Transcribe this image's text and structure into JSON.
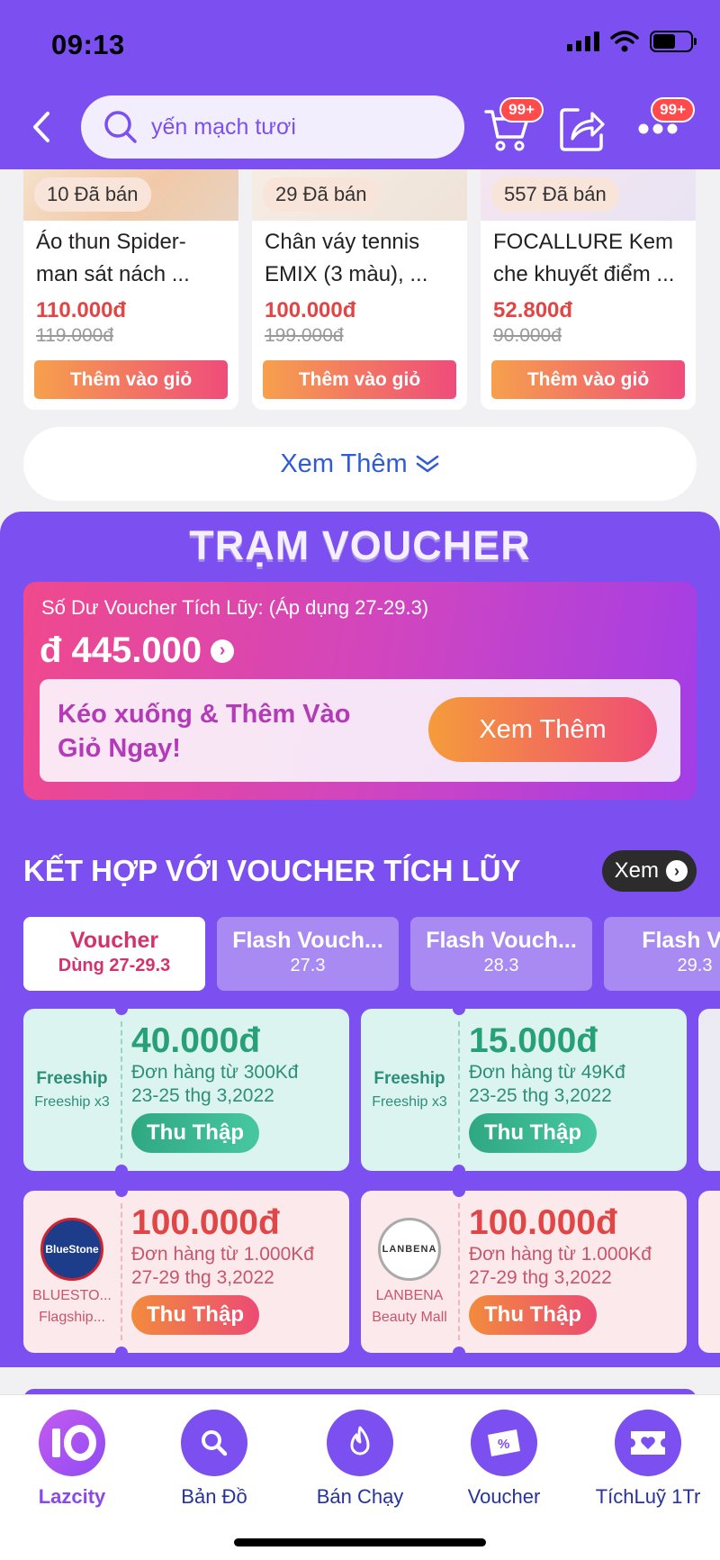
{
  "status_bar": {
    "time": "09:13"
  },
  "header": {
    "search_text": "yến mạch tươi",
    "cart_badge": "99+",
    "more_badge": "99+"
  },
  "products": [
    {
      "sold": "10 Đã bán",
      "name": "Áo thun Spider-man sát nách  ...",
      "price": "110.000đ",
      "old_price": "119.000đ",
      "button": "Thêm vào giỏ"
    },
    {
      "sold": "29 Đã bán",
      "name": "Chân váy tennis EMIX (3 màu), ...",
      "price": "100.000đ",
      "old_price": "199.000đ",
      "button": "Thêm vào giỏ"
    },
    {
      "sold": "557 Đã bán",
      "name": "FOCALLURE Kem che khuyết điểm ...",
      "price": "52.800đ",
      "old_price": "90.000đ",
      "button": "Thêm vào giỏ"
    }
  ],
  "see_more": "Xem Thêm",
  "voucher_station": {
    "title": "TRẠM VOUCHER",
    "balance_label": "Số Dư Voucher Tích Lũy: (Áp dụng 27-29.3)",
    "balance_amount": "đ 445.000",
    "cta_text": "Kéo xuống & Thêm Vào Giỏ Ngay!",
    "cta_button": "Xem Thêm"
  },
  "combo": {
    "title": "KẾT HỢP VỚI VOUCHER TÍCH LŨY",
    "link": "Xem",
    "tabs": [
      {
        "name": "Voucher",
        "date": "Dùng 27-29.3"
      },
      {
        "name": "Flash Vouch...",
        "date": "27.3"
      },
      {
        "name": "Flash Vouch...",
        "date": "28.3"
      },
      {
        "name": "Flash Vou",
        "date": "29.3"
      }
    ],
    "row1": [
      {
        "brand": "Freeship",
        "sub": "Freeship x3",
        "amount": "40.000đ",
        "condition": "Đơn hàng từ 300Kđ",
        "date": "23-25 thg 3,2022",
        "button": "Thu Thập"
      },
      {
        "brand": "Freeship",
        "sub": "Freeship x3",
        "amount": "15.000đ",
        "condition": "Đơn hàng từ 49Kđ",
        "date": "23-25 thg 3,2022",
        "button": "Thu Thập"
      }
    ],
    "row2": [
      {
        "brand": "BLUESTO...",
        "sub": "Flagship...",
        "logo": "BlueStone",
        "amount": "100.000đ",
        "condition": "Đơn hàng từ 1.000Kđ",
        "date": "27-29 thg 3,2022",
        "button": "Thu Thập"
      },
      {
        "brand": "LANBENA",
        "sub": "Beauty Mall",
        "logo": "LANBENA",
        "amount": "100.000đ",
        "condition": "Đơn hàng từ 1.000Kđ",
        "date": "27-29 thg 3,2022",
        "button": "Thu Thập"
      }
    ]
  },
  "bottom_nav": [
    {
      "label": "Lazcity",
      "icon": "lazcity-10-icon"
    },
    {
      "label": "Bản Đồ",
      "icon": "search-icon"
    },
    {
      "label": "Bán Chạy",
      "icon": "fire-icon"
    },
    {
      "label": "Voucher",
      "icon": "voucher-percent-icon"
    },
    {
      "label": "TíchLuỹ 1Tr",
      "icon": "ticket-heart-icon"
    }
  ],
  "colors": {
    "brand_purple": "#7b4ff0",
    "price_red": "#e04646",
    "freeship_green": "#27a078"
  }
}
